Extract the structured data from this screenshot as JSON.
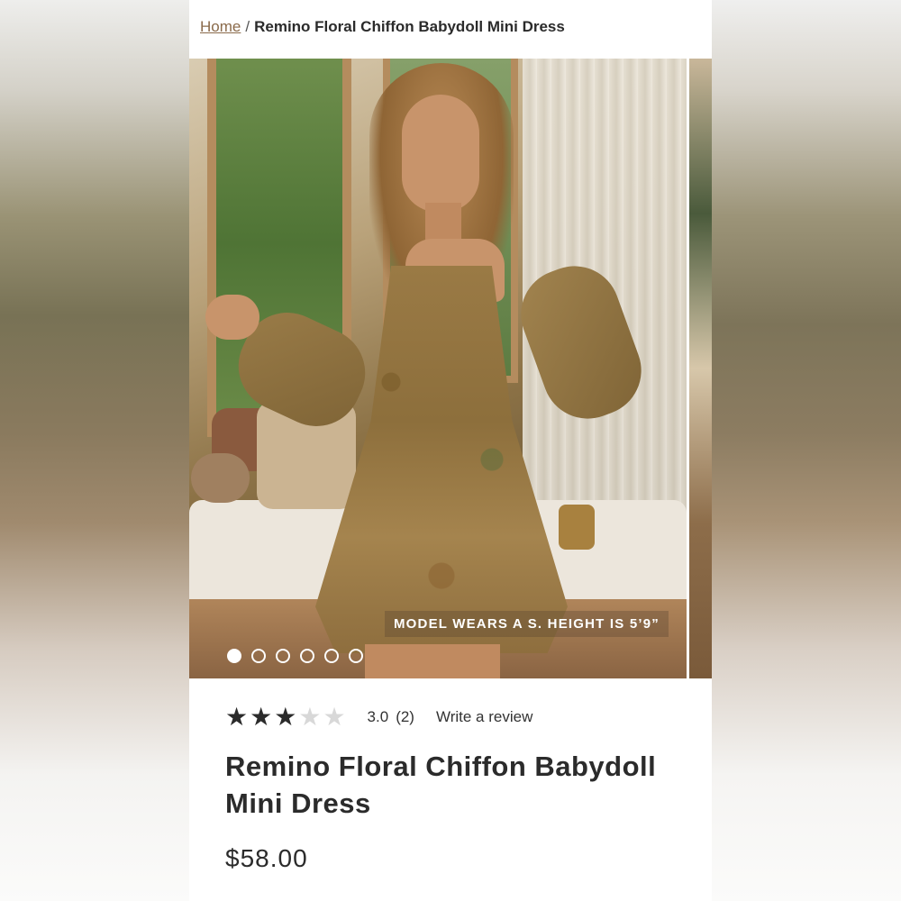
{
  "breadcrumb": {
    "home": "Home",
    "separator": "/",
    "current": "Remino Floral Chiffon Babydoll Mini Dress"
  },
  "gallery": {
    "caption": "MODEL WEARS A S. HEIGHT IS 5’9”",
    "slide_count": 6,
    "active_slide": 1
  },
  "rating": {
    "stars": 3,
    "max_stars": 5,
    "value": "3.0",
    "count": "(2)",
    "write_review": "Write a review"
  },
  "product": {
    "title": "Remino Floral Chiffon Babydoll Mini Dress",
    "price": "$58.00"
  },
  "icons": {
    "star_filled": "star-filled-icon",
    "star_empty": "star-empty-icon"
  },
  "colors": {
    "link": "#8a6a4a",
    "text": "#2b2b2b",
    "star_on": "#2b2b2b",
    "star_off": "#d8d8d8"
  }
}
